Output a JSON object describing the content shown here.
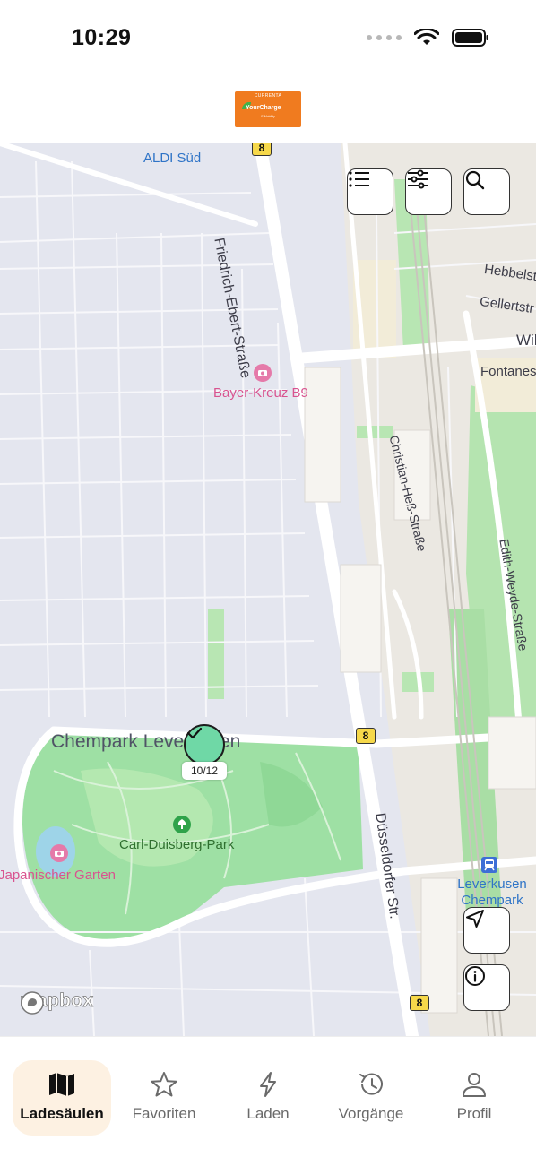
{
  "status_bar": {
    "time": "10:29"
  },
  "header": {
    "logo_top": "CURRENTA",
    "logo_main": "YourCharge",
    "logo_sub": "E-Mobility"
  },
  "map": {
    "labels": {
      "aldi": "ALDI Süd",
      "friedrich": "Friedrich-Ebert-Straße",
      "hebbels": "Hebbelst",
      "gellert": "Gellertstr",
      "wil": "Wil",
      "fontanes": "Fontanes",
      "bayer": "Bayer-Kreuz B9",
      "christian": "Christian-Heß-Straße",
      "edith": "Edith-Weyde-Straße",
      "chempark": "Chempark Leverkusen",
      "carl": "Carl-Duisberg-Park",
      "japan": "Japanischer Garten",
      "duessel": "Düsseldorfer Str.",
      "leverkusen": "Leverkusen Chempark"
    },
    "road_number": "8",
    "charger": {
      "count": "10/12",
      "status": "available"
    },
    "attribution": "mapbox"
  },
  "map_controls": {
    "list": "list-icon",
    "filter": "sliders-icon",
    "search": "search-icon",
    "locate": "navigation-arrow-icon",
    "info": "info-icon"
  },
  "tabs": [
    {
      "label": "Ladesäulen",
      "icon": "map-icon",
      "active": true
    },
    {
      "label": "Favoriten",
      "icon": "star-icon",
      "active": false
    },
    {
      "label": "Laden",
      "icon": "bolt-icon",
      "active": false
    },
    {
      "label": "Vorgänge",
      "icon": "history-icon",
      "active": false
    },
    {
      "label": "Profil",
      "icon": "user-icon",
      "active": false
    }
  ],
  "colors": {
    "accent": "#f07b1f",
    "charger": "#6fd8a6",
    "active_tab_bg": "#fdf1e2",
    "park": "#9ee0a4"
  }
}
